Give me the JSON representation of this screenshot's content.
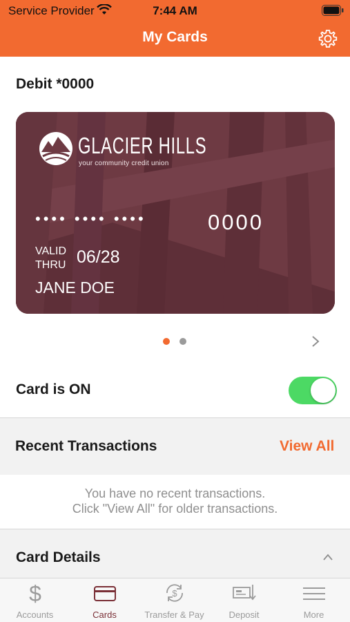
{
  "status_bar": {
    "carrier": "Service Provider",
    "time": "7:44 AM"
  },
  "nav": {
    "title": "My Cards"
  },
  "card_section": {
    "label": "Debit *0000",
    "card": {
      "brand": "GLACIER HILLS",
      "tagline": "your community credit union",
      "number_masked": "•••• •••• ••••",
      "number_last4": "0000",
      "valid_thru_label": "VALID THRU",
      "expiry": "06/28",
      "cardholder": "JANE DOE"
    },
    "pager": {
      "active_index": 0,
      "count": 2
    }
  },
  "card_toggle": {
    "label": "Card is ON",
    "on": true
  },
  "recent_transactions": {
    "title": "Recent Transactions",
    "view_all": "View All",
    "empty_line1": "You have no recent transactions.",
    "empty_line2": "Click \"View All\" for older transactions."
  },
  "card_details": {
    "title": "Card Details"
  },
  "tabbar": {
    "tabs": [
      {
        "label": "Accounts",
        "icon": "dollar-icon",
        "active": false
      },
      {
        "label": "Cards",
        "icon": "card-icon",
        "active": true
      },
      {
        "label": "Transfer & Pay",
        "icon": "transfer-icon",
        "active": false
      },
      {
        "label": "Deposit",
        "icon": "deposit-icon",
        "active": false
      },
      {
        "label": "More",
        "icon": "menu-icon",
        "active": false
      }
    ]
  },
  "colors": {
    "accent": "#f26a30",
    "card_bg": "#6e3a43",
    "toggle_on": "#4cd964",
    "tab_active": "#7a2f36"
  }
}
